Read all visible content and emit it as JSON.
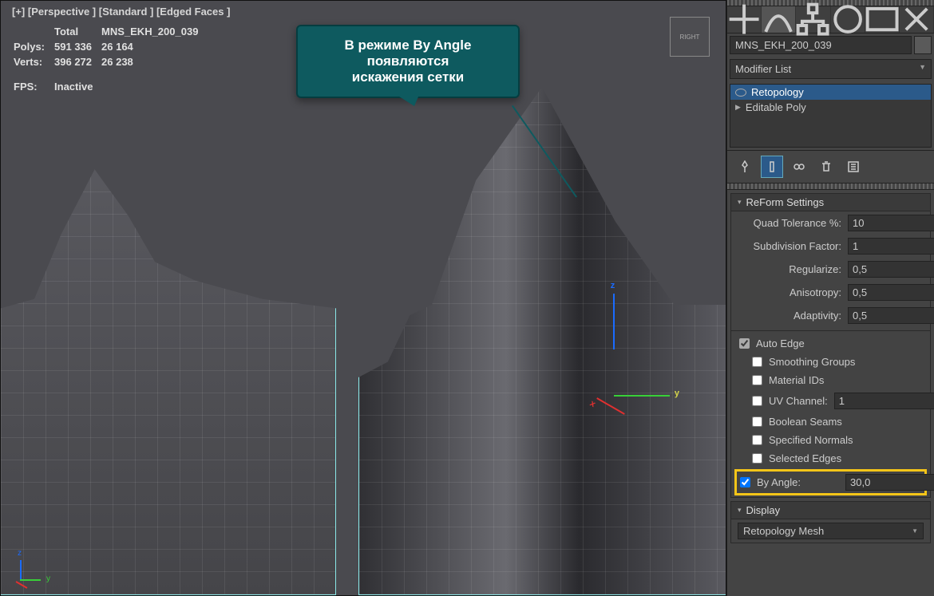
{
  "viewport": {
    "labels": "[+] [Perspective ]  [Standard ] [Edged Faces ]",
    "stats_headers": {
      "total": "Total",
      "object": "MNS_EKH_200_039"
    },
    "polys_label": "Polys:",
    "polys_total": "591 336",
    "polys_obj": "26 164",
    "verts_label": "Verts:",
    "verts_total": "396 272",
    "verts_obj": "26 238",
    "fps_label": "FPS:",
    "fps_value": "Inactive",
    "viewcube": "RIGHT"
  },
  "callout": {
    "line1": "В режиме By Angle",
    "line2": "появляются",
    "line3": "искажения сетки"
  },
  "panel": {
    "object_name": "MNS_EKH_200_039",
    "modifier_list_label": "Modifier List",
    "stack": {
      "retopology": "Retopology",
      "editable_poly": "Editable Poly"
    },
    "reform_header": "ReForm Settings",
    "quad_tol_label": "Quad Tolerance %:",
    "quad_tol_val": "10",
    "subdiv_label": "Subdivision Factor:",
    "subdiv_val": "1",
    "regularize_label": "Regularize:",
    "regularize_val": "0,5",
    "anisotropy_label": "Anisotropy:",
    "anisotropy_val": "0,5",
    "adaptivity_label": "Adaptivity:",
    "adaptivity_val": "0,5",
    "auto_edge": "Auto Edge",
    "smoothing_groups": "Smoothing Groups",
    "material_ids": "Material IDs",
    "uv_channel": "UV Channel:",
    "uv_channel_val": "1",
    "boolean_seams": "Boolean Seams",
    "specified_normals": "Specified Normals",
    "selected_edges": "Selected Edges",
    "by_angle": "By Angle:",
    "by_angle_val": "30,0",
    "display_header": "Display",
    "display_mode": "Retopology Mesh"
  }
}
